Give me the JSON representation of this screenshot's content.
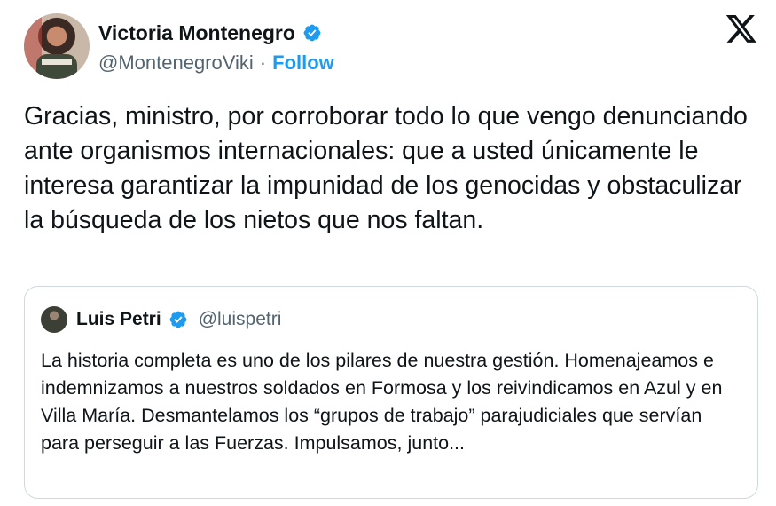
{
  "author": {
    "name": "Victoria Montenegro",
    "handle": "@MontenegroViki",
    "separator": "·",
    "follow_label": "Follow",
    "verified_icon": "verified-badge-icon",
    "verified_color": "#1d9bf0"
  },
  "platform": {
    "logo": "x-logo-icon"
  },
  "tweet": {
    "text": "Gracias, ministro, por corroborar todo lo que vengo denunciando ante organismos internacionales: que a usted únicamente le interesa garantizar la impunidad de los genocidas y obstaculizar la búsqueda de los nietos que nos faltan."
  },
  "quoted": {
    "name": "Luis Petri",
    "handle": "@luispetri",
    "text": "La historia completa es uno de los pilares de nuestra gestión. Homenajeamos e indemnizamos a nuestros soldados en Formosa y los reivindicamos en Azul y en Villa María. Desmantelamos los “grupos de trabajo” parajudiciales que servían para perseguir a las Fuerzas. Impulsamos, junto..."
  },
  "colors": {
    "text": "#0f1419",
    "secondary": "#536471",
    "accent": "#1d9bf0",
    "border": "#cfd9de"
  }
}
